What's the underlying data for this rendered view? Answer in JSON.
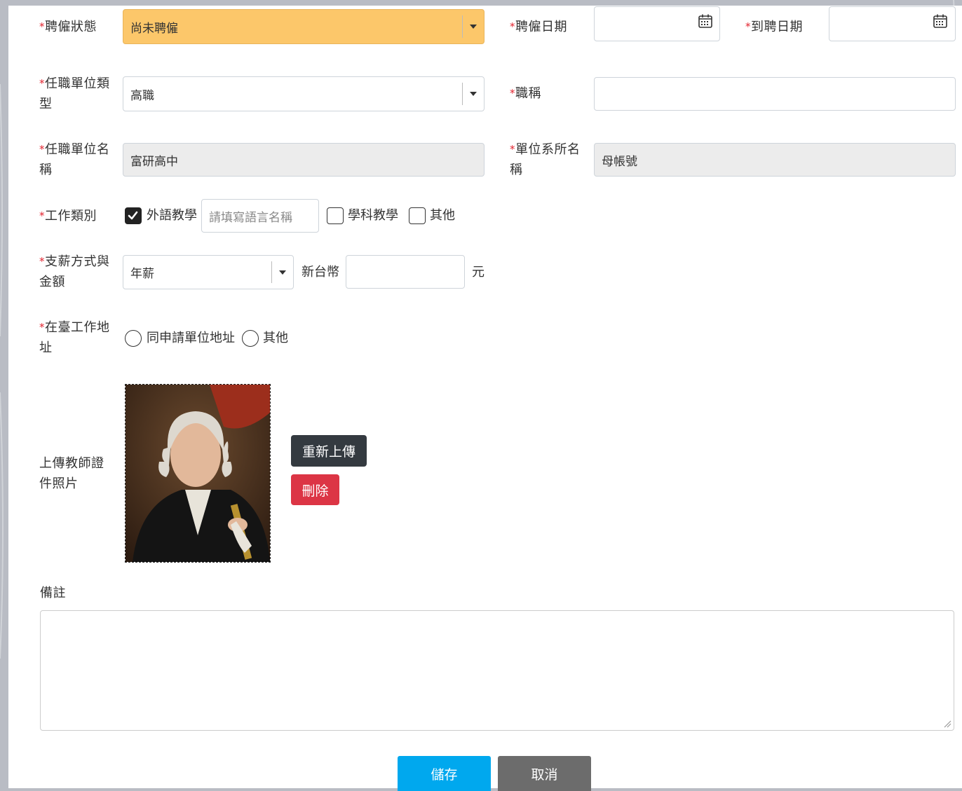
{
  "colors": {
    "accent_orange": "#fcc76a",
    "required_mark": "#e2242f",
    "dark_button": "#343a40",
    "danger_button": "#dc3545",
    "primary_button": "#00a8ee",
    "secondary_button": "#6c6c6c"
  },
  "required_mark": "*",
  "employment": {
    "status_label": "聘僱狀態",
    "status_value": "尚未聘僱",
    "hire_date_label": "聘僱日期",
    "arrival_date_label": "到聘日期",
    "calendar_icon": "calendar-icon"
  },
  "unit": {
    "type_label_1": "任職單位類",
    "type_label_2": "型",
    "type_value": "高職",
    "title_label": "職稱",
    "name_label_1": "任職單位名",
    "name_label_2": "稱",
    "name_value": "富研高中",
    "dept_label_1": "單位系所名",
    "dept_label_2": "稱",
    "dept_value": "母帳號"
  },
  "work_type": {
    "label": "工作類別",
    "options": [
      {
        "label": "外語教學",
        "checked": true
      },
      {
        "label": "學科教學",
        "checked": false
      },
      {
        "label": "其他",
        "checked": false
      }
    ],
    "language_placeholder": "請填寫語言名稱"
  },
  "salary": {
    "label_1": "支薪方式與",
    "label_2": "金額",
    "method_value": "年薪",
    "currency_label": "新台幣",
    "amount_value": "",
    "unit_label": "元"
  },
  "address": {
    "label_1": "在臺工作地",
    "label_2": "址",
    "options": [
      {
        "label": "同申請單位地址",
        "selected": false
      },
      {
        "label": "其他",
        "selected": false
      }
    ]
  },
  "photo": {
    "label_1": "上傳教師證",
    "label_2": "件照片",
    "reupload_label": "重新上傳",
    "delete_label": "刪除"
  },
  "remarks": {
    "label": "備註",
    "value": ""
  },
  "actions": {
    "save_label": "儲存",
    "cancel_label": "取消"
  }
}
